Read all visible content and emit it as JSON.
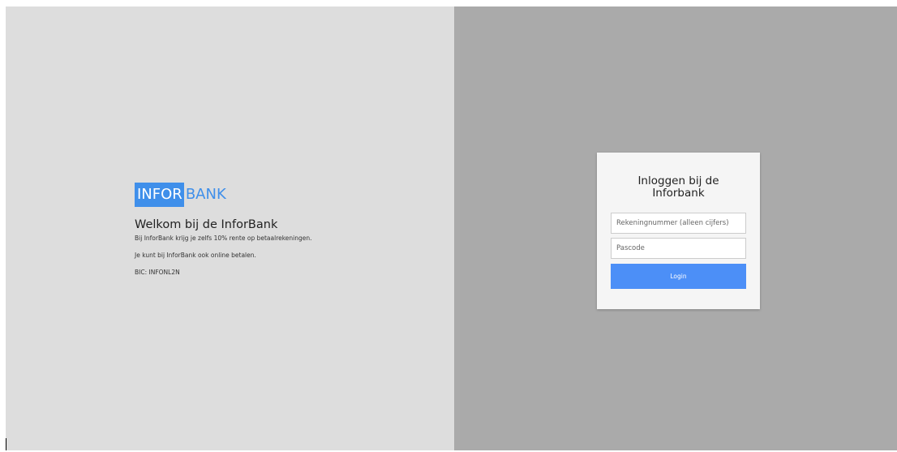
{
  "logo": {
    "part1": "INFOR",
    "part2": "BANK",
    "color": "#3f8fea"
  },
  "welcome": {
    "title": "Welkom bij de InforBank",
    "line1": "Bij InforBank krijg je zelfs 10% rente op betaalrekeningen.",
    "line2": "Je kunt bij InforBank ook online betalen.",
    "bic": "BIC: INFONL2N"
  },
  "login": {
    "title": "Inloggen bij de Inforbank",
    "account_placeholder": "Rekeningnummer (alleen cijfers)",
    "passcode_placeholder": "Pascode",
    "button_label": "Login",
    "button_color": "#4c8ff7"
  },
  "colors": {
    "left_background": "#dddddd",
    "right_background": "#aaaaaa",
    "card_background": "#f5f5f5"
  }
}
